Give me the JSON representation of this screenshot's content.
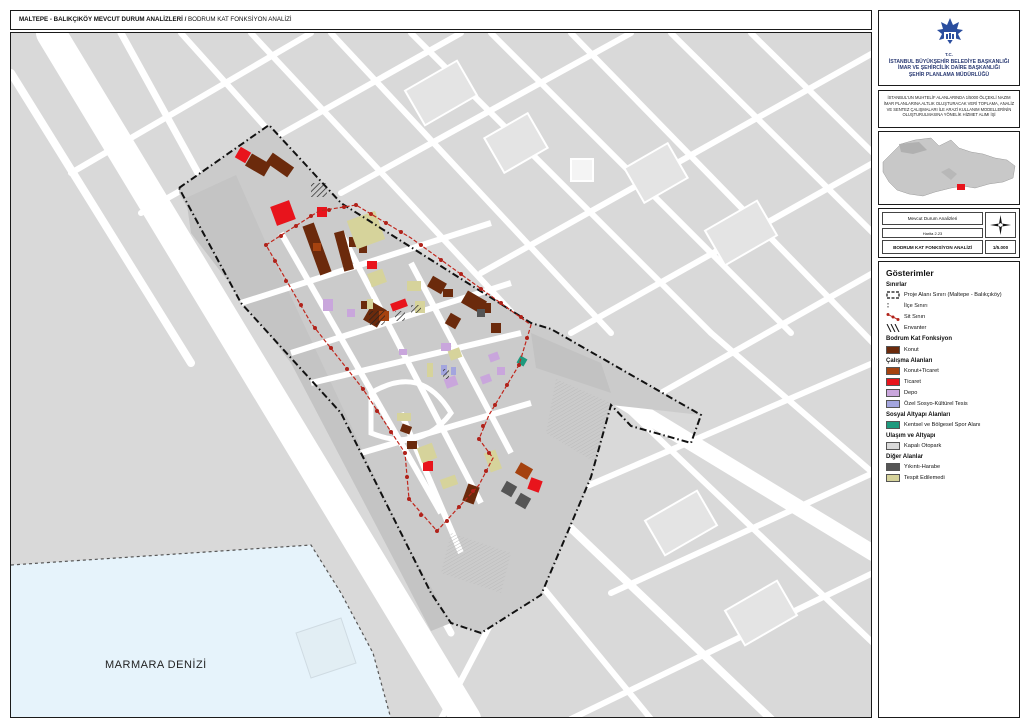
{
  "header": {
    "title_bold": "MALTEPE - BALIKÇIKÖY MEVCUT DURUM ANALİZLERİ /",
    "title_rest": " BODRUM KAT FONKSİYON ANALİZİ"
  },
  "logo": {
    "tc": "T.C.",
    "org_line1": "İSTANBUL BÜYÜKŞEHİR BELEDİYE BAŞKANLIĞI",
    "org_line2": "İMAR VE ŞEHİRCİLİK DAİRE BAŞKANLIĞI",
    "org_line3": "ŞEHİR PLANLAMA MÜDÜRLÜĞÜ"
  },
  "project": {
    "text": "İSTANBUL'UN MUHTELİF ALANLARINDA 1/5000 ÖLÇEKLİ NAZIM İMAR PLANLARINA ALTLIK OLUŞTURACAK VERİ TOPLAMA, ANALİZ VE SENTEZ ÇALIŞMALARI İLE ARAZİ KULLANIM MODELLERİNİN OLUŞTURULMASINA YÖNELİK HİZMET ALIMI İŞİ"
  },
  "info": {
    "analysis": "Mevcut Durum Analizleri",
    "map_no": "Harita 2.23",
    "map_name": "BODRUM KAT FONKSİYON ANALİZİ",
    "scale": "1/5.000"
  },
  "map": {
    "sea_label": "MARMARA DENİZİ",
    "colors": {
      "sea": "#e6f3fb",
      "land": "#d9d9d9",
      "road": "#ffffff",
      "block": "#cfcfcf",
      "konut": "#6b2a0c",
      "konut_ticaret": "#a5420f",
      "ticaret": "#e8141c",
      "depo": "#c9a6dc",
      "ozel": "#a3a5de",
      "spor": "#1e9a7e",
      "harabe": "#555555",
      "tespit": "#d6d39b",
      "site": "#c0261c"
    }
  },
  "legend": {
    "title": "Gösterimler",
    "groups": [
      {
        "heading": "Sınırlar",
        "items": [
          {
            "label": "Proje Alanı Sınırı (Maltepe - Balıkçıköy)",
            "icon": "project-boundary-icon"
          },
          {
            "label": "İlçe Sınırı",
            "icon": "district-boundary-icon"
          },
          {
            "label": "Sit Sınırı",
            "icon": "site-boundary-icon"
          },
          {
            "label": "Envanter",
            "icon": "inventory-hatch-icon"
          }
        ]
      },
      {
        "heading": "Bodrum Kat Fonksiyon",
        "items": [
          {
            "label": "Konut",
            "color": "#6b2a0c"
          }
        ]
      },
      {
        "heading": "Çalışma Alanları",
        "items": [
          {
            "label": "Konut+Ticaret",
            "color": "#a5420f"
          },
          {
            "label": "Ticaret",
            "color": "#e8141c"
          },
          {
            "label": "Depo",
            "color": "#c9a6dc"
          },
          {
            "label": "Özel Sosyo-Kültürel Tesis",
            "color": "#a3a5de"
          }
        ]
      },
      {
        "heading": "Sosyal Altyapı Alanları",
        "items": [
          {
            "label": "Kentsel ve Bölgesel Spor Alanı",
            "color": "#1e9a7e"
          }
        ]
      },
      {
        "heading": "Ulaşım ve Altyapı",
        "items": [
          {
            "label": "Kapalı Otopark",
            "color": "#d9d9d9"
          }
        ]
      },
      {
        "heading": "Diğer Alanlar",
        "items": [
          {
            "label": "Yıkıntı-Harabe",
            "color": "#555555"
          },
          {
            "label": "Tespit Edilemedi",
            "color": "#d6d39b"
          }
        ]
      }
    ]
  }
}
